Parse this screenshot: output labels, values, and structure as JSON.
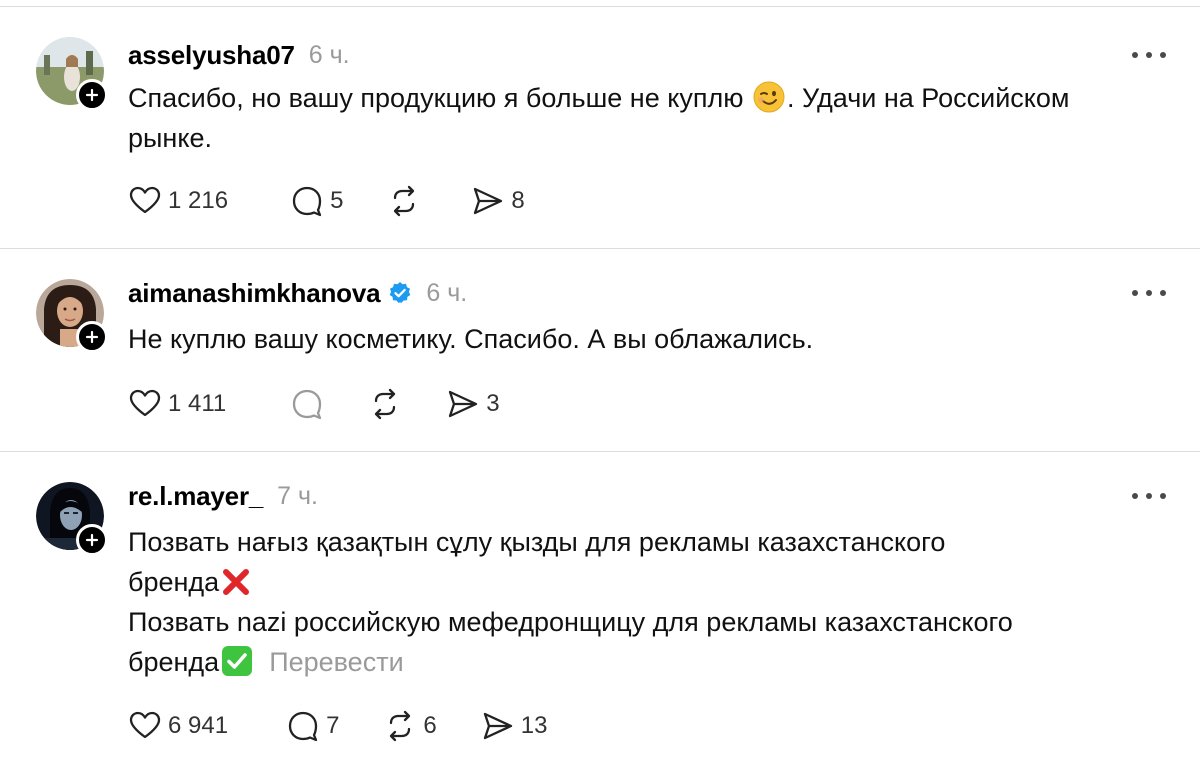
{
  "posts": [
    {
      "username": "asselyusha07",
      "verified": false,
      "time": "6 ч.",
      "text_lines": [
        "Спасибо, но вашу продукцию я больше не куплю",
        ". Удачи на Российском",
        "рынке."
      ],
      "emoji": "winking-face",
      "likes": "1 216",
      "comments": "5",
      "reposts": "",
      "shares": "8"
    },
    {
      "username": "aimanashimkhanova",
      "verified": true,
      "time": "6 ч.",
      "text": "Не куплю вашу косметику. Спасибо. А вы облажались.",
      "likes": "1 411",
      "comments": "",
      "reposts": "",
      "shares": "3"
    },
    {
      "username": "re.l.mayer_",
      "verified": false,
      "time": "7 ч.",
      "line1": "Позвать нағыз қазақтын сұлу қызды для рекламы казахстанского",
      "line2": "бренда",
      "line2_emoji": "cross-mark",
      "line3": "Позвать nazi российскую мефедронщицу для рекламы казахстанского",
      "line4": "бренда",
      "line4_emoji": "check-mark-button",
      "translate": "Перевести",
      "likes": "6 941",
      "comments": "7",
      "reposts": "6",
      "shares": "13"
    }
  ],
  "colors": {
    "verified": "#1d9bf0",
    "muted": "#9a9a9a",
    "cross": "#e0262b",
    "check": "#3ec43e"
  }
}
